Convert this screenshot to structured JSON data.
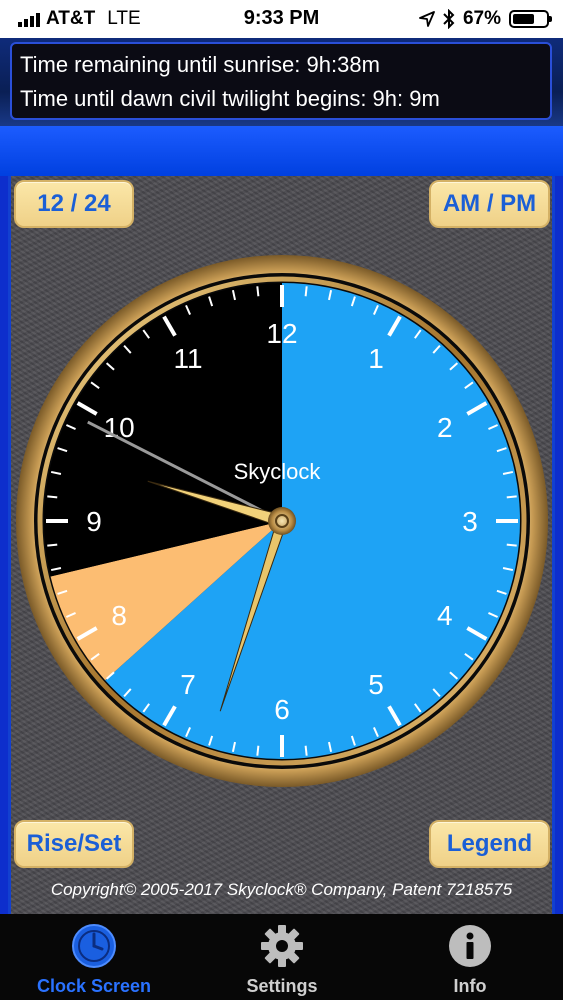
{
  "status_bar": {
    "carrier": "AT&T",
    "network": "LTE",
    "time": "9:33 PM",
    "battery": "67%",
    "battery_level": 0.67
  },
  "info": {
    "line1": "Time remaining until sunrise:  9h:38m",
    "line2": "Time until dawn civil twilight begins:  9h: 9m"
  },
  "buttons": {
    "format": "12 / 24",
    "ampm": "AM / PM",
    "rise_set": "Rise/Set",
    "legend": "Legend"
  },
  "clock": {
    "title": "Skyclock",
    "numbers": [
      "12",
      "1",
      "2",
      "3",
      "4",
      "5",
      "6",
      "7",
      "8",
      "9",
      "10",
      "11"
    ],
    "current_time": "9:33",
    "segments": [
      {
        "from_hour": 0,
        "to_hour": 6.6,
        "color": "#1ea3f5"
      },
      {
        "from_hour": 6.6,
        "to_hour": 8.2,
        "color": "#1ea3f5"
      },
      {
        "from_hour": 7.7,
        "to_hour": 8.6,
        "color": "#fcbd72"
      },
      {
        "from_hour": 8.6,
        "to_hour": 12,
        "color": "#000000"
      }
    ],
    "colors": {
      "day": "#1ea3f5",
      "twilight": "#fcbd72",
      "night": "#000000",
      "rim": "#c79a4e"
    }
  },
  "copyright": "Copyright© 2005-2017 Skyclock® Company, Patent 7218575",
  "tabs": [
    {
      "label": "Clock Screen",
      "icon": "clock-icon",
      "active": true
    },
    {
      "label": "Settings",
      "icon": "gear-icon",
      "active": false
    },
    {
      "label": "Info",
      "icon": "info-icon",
      "active": false
    }
  ]
}
